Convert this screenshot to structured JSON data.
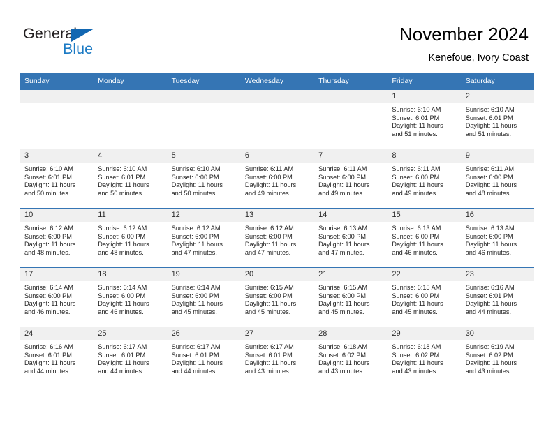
{
  "brand": {
    "name_part1": "General",
    "name_part2": "Blue",
    "triangle_icon": "triangle-icon",
    "accent_color": "#1b7ac4"
  },
  "header": {
    "title": "November 2024",
    "subtitle": "Kenefoue, Ivory Coast",
    "header_bg_color": "#3575b4",
    "daynum_bg_color": "#f0f0f0"
  },
  "weekdays": [
    "Sunday",
    "Monday",
    "Tuesday",
    "Wednesday",
    "Thursday",
    "Friday",
    "Saturday"
  ],
  "weeks": [
    [
      {
        "day": "",
        "blank": true,
        "sunrise": "",
        "sunset": "",
        "daylight1": "",
        "daylight2": ""
      },
      {
        "day": "",
        "blank": true,
        "sunrise": "",
        "sunset": "",
        "daylight1": "",
        "daylight2": ""
      },
      {
        "day": "",
        "blank": true,
        "sunrise": "",
        "sunset": "",
        "daylight1": "",
        "daylight2": ""
      },
      {
        "day": "",
        "blank": true,
        "sunrise": "",
        "sunset": "",
        "daylight1": "",
        "daylight2": ""
      },
      {
        "day": "",
        "blank": true,
        "sunrise": "",
        "sunset": "",
        "daylight1": "",
        "daylight2": ""
      },
      {
        "day": "1",
        "blank": false,
        "sunrise": "Sunrise: 6:10 AM",
        "sunset": "Sunset: 6:01 PM",
        "daylight1": "Daylight: 11 hours",
        "daylight2": "and 51 minutes."
      },
      {
        "day": "2",
        "blank": false,
        "sunrise": "Sunrise: 6:10 AM",
        "sunset": "Sunset: 6:01 PM",
        "daylight1": "Daylight: 11 hours",
        "daylight2": "and 51 minutes."
      }
    ],
    [
      {
        "day": "3",
        "blank": false,
        "sunrise": "Sunrise: 6:10 AM",
        "sunset": "Sunset: 6:01 PM",
        "daylight1": "Daylight: 11 hours",
        "daylight2": "and 50 minutes."
      },
      {
        "day": "4",
        "blank": false,
        "sunrise": "Sunrise: 6:10 AM",
        "sunset": "Sunset: 6:01 PM",
        "daylight1": "Daylight: 11 hours",
        "daylight2": "and 50 minutes."
      },
      {
        "day": "5",
        "blank": false,
        "sunrise": "Sunrise: 6:10 AM",
        "sunset": "Sunset: 6:00 PM",
        "daylight1": "Daylight: 11 hours",
        "daylight2": "and 50 minutes."
      },
      {
        "day": "6",
        "blank": false,
        "sunrise": "Sunrise: 6:11 AM",
        "sunset": "Sunset: 6:00 PM",
        "daylight1": "Daylight: 11 hours",
        "daylight2": "and 49 minutes."
      },
      {
        "day": "7",
        "blank": false,
        "sunrise": "Sunrise: 6:11 AM",
        "sunset": "Sunset: 6:00 PM",
        "daylight1": "Daylight: 11 hours",
        "daylight2": "and 49 minutes."
      },
      {
        "day": "8",
        "blank": false,
        "sunrise": "Sunrise: 6:11 AM",
        "sunset": "Sunset: 6:00 PM",
        "daylight1": "Daylight: 11 hours",
        "daylight2": "and 49 minutes."
      },
      {
        "day": "9",
        "blank": false,
        "sunrise": "Sunrise: 6:11 AM",
        "sunset": "Sunset: 6:00 PM",
        "daylight1": "Daylight: 11 hours",
        "daylight2": "and 48 minutes."
      }
    ],
    [
      {
        "day": "10",
        "blank": false,
        "sunrise": "Sunrise: 6:12 AM",
        "sunset": "Sunset: 6:00 PM",
        "daylight1": "Daylight: 11 hours",
        "daylight2": "and 48 minutes."
      },
      {
        "day": "11",
        "blank": false,
        "sunrise": "Sunrise: 6:12 AM",
        "sunset": "Sunset: 6:00 PM",
        "daylight1": "Daylight: 11 hours",
        "daylight2": "and 48 minutes."
      },
      {
        "day": "12",
        "blank": false,
        "sunrise": "Sunrise: 6:12 AM",
        "sunset": "Sunset: 6:00 PM",
        "daylight1": "Daylight: 11 hours",
        "daylight2": "and 47 minutes."
      },
      {
        "day": "13",
        "blank": false,
        "sunrise": "Sunrise: 6:12 AM",
        "sunset": "Sunset: 6:00 PM",
        "daylight1": "Daylight: 11 hours",
        "daylight2": "and 47 minutes."
      },
      {
        "day": "14",
        "blank": false,
        "sunrise": "Sunrise: 6:13 AM",
        "sunset": "Sunset: 6:00 PM",
        "daylight1": "Daylight: 11 hours",
        "daylight2": "and 47 minutes."
      },
      {
        "day": "15",
        "blank": false,
        "sunrise": "Sunrise: 6:13 AM",
        "sunset": "Sunset: 6:00 PM",
        "daylight1": "Daylight: 11 hours",
        "daylight2": "and 46 minutes."
      },
      {
        "day": "16",
        "blank": false,
        "sunrise": "Sunrise: 6:13 AM",
        "sunset": "Sunset: 6:00 PM",
        "daylight1": "Daylight: 11 hours",
        "daylight2": "and 46 minutes."
      }
    ],
    [
      {
        "day": "17",
        "blank": false,
        "sunrise": "Sunrise: 6:14 AM",
        "sunset": "Sunset: 6:00 PM",
        "daylight1": "Daylight: 11 hours",
        "daylight2": "and 46 minutes."
      },
      {
        "day": "18",
        "blank": false,
        "sunrise": "Sunrise: 6:14 AM",
        "sunset": "Sunset: 6:00 PM",
        "daylight1": "Daylight: 11 hours",
        "daylight2": "and 46 minutes."
      },
      {
        "day": "19",
        "blank": false,
        "sunrise": "Sunrise: 6:14 AM",
        "sunset": "Sunset: 6:00 PM",
        "daylight1": "Daylight: 11 hours",
        "daylight2": "and 45 minutes."
      },
      {
        "day": "20",
        "blank": false,
        "sunrise": "Sunrise: 6:15 AM",
        "sunset": "Sunset: 6:00 PM",
        "daylight1": "Daylight: 11 hours",
        "daylight2": "and 45 minutes."
      },
      {
        "day": "21",
        "blank": false,
        "sunrise": "Sunrise: 6:15 AM",
        "sunset": "Sunset: 6:00 PM",
        "daylight1": "Daylight: 11 hours",
        "daylight2": "and 45 minutes."
      },
      {
        "day": "22",
        "blank": false,
        "sunrise": "Sunrise: 6:15 AM",
        "sunset": "Sunset: 6:00 PM",
        "daylight1": "Daylight: 11 hours",
        "daylight2": "and 45 minutes."
      },
      {
        "day": "23",
        "blank": false,
        "sunrise": "Sunrise: 6:16 AM",
        "sunset": "Sunset: 6:01 PM",
        "daylight1": "Daylight: 11 hours",
        "daylight2": "and 44 minutes."
      }
    ],
    [
      {
        "day": "24",
        "blank": false,
        "sunrise": "Sunrise: 6:16 AM",
        "sunset": "Sunset: 6:01 PM",
        "daylight1": "Daylight: 11 hours",
        "daylight2": "and 44 minutes."
      },
      {
        "day": "25",
        "blank": false,
        "sunrise": "Sunrise: 6:17 AM",
        "sunset": "Sunset: 6:01 PM",
        "daylight1": "Daylight: 11 hours",
        "daylight2": "and 44 minutes."
      },
      {
        "day": "26",
        "blank": false,
        "sunrise": "Sunrise: 6:17 AM",
        "sunset": "Sunset: 6:01 PM",
        "daylight1": "Daylight: 11 hours",
        "daylight2": "and 44 minutes."
      },
      {
        "day": "27",
        "blank": false,
        "sunrise": "Sunrise: 6:17 AM",
        "sunset": "Sunset: 6:01 PM",
        "daylight1": "Daylight: 11 hours",
        "daylight2": "and 43 minutes."
      },
      {
        "day": "28",
        "blank": false,
        "sunrise": "Sunrise: 6:18 AM",
        "sunset": "Sunset: 6:02 PM",
        "daylight1": "Daylight: 11 hours",
        "daylight2": "and 43 minutes."
      },
      {
        "day": "29",
        "blank": false,
        "sunrise": "Sunrise: 6:18 AM",
        "sunset": "Sunset: 6:02 PM",
        "daylight1": "Daylight: 11 hours",
        "daylight2": "and 43 minutes."
      },
      {
        "day": "30",
        "blank": false,
        "sunrise": "Sunrise: 6:19 AM",
        "sunset": "Sunset: 6:02 PM",
        "daylight1": "Daylight: 11 hours",
        "daylight2": "and 43 minutes."
      }
    ]
  ]
}
